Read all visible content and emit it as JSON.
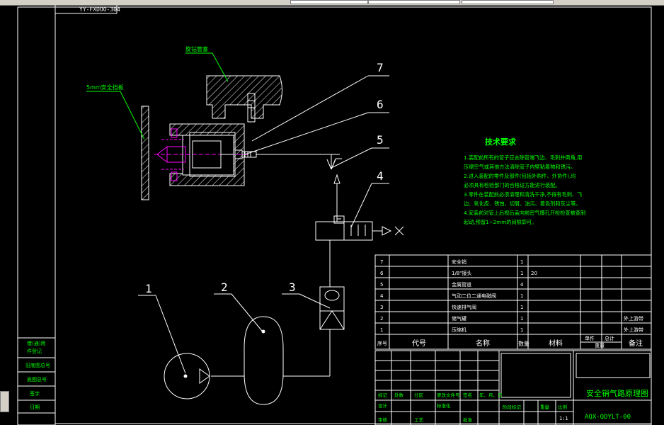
{
  "header_label": "YY-FXDOO-304",
  "colors": {
    "frame": "#ffffff",
    "leader": "#00ff00",
    "accent": "#ff00ff",
    "annotation": "#00ff00",
    "text": "#ffffff"
  },
  "callouts": {
    "air_pipe": "旋钻管塞",
    "safety_plate": "5mm安全挡板"
  },
  "part_numbers": [
    "1",
    "2",
    "3",
    "4",
    "5",
    "6",
    "7"
  ],
  "tech_req": {
    "title": "技术要求",
    "lines": [
      "1.装配前所有的管子应去除管端飞边、毛刺并倒角,用",
      "压缩空气或其他方法清除管子内壁粘着物和锈污。",
      "2.进入装配的零件及部件(包括外购件、外协件),均",
      "必须具有检验部门的合格证方能进行装配。",
      "3.零件在装配前必须清理和清洗干净,不得有毛刺、飞",
      "边、氧化皮、锈蚀、切屑、油污、着色剂和灰尘等。",
      "4.安装前对管上后视后盖向前密气爆孔开检检查被查制",
      "起动,预留1~2mm的间隙即可。"
    ]
  },
  "bom": {
    "rows": [
      {
        "no": "7",
        "name": "安全销",
        "qty": "1",
        "material": "",
        "note": ""
      },
      {
        "no": "6",
        "name": "1/8\"接头",
        "qty": "1",
        "material": "20",
        "note": ""
      },
      {
        "no": "5",
        "name": "金属管道",
        "qty": "4",
        "material": "",
        "note": ""
      },
      {
        "no": "4",
        "name": "气动二位二通电磁阀",
        "qty": "1",
        "material": "",
        "note": ""
      },
      {
        "no": "3",
        "name": "快速排气阀",
        "qty": "1",
        "material": "",
        "note": ""
      },
      {
        "no": "2",
        "name": "储气罐",
        "qty": "1",
        "material": "",
        "note": "外上游带"
      },
      {
        "no": "1",
        "name": "压缩机",
        "qty": "1",
        "material": "",
        "note": "外上游带"
      }
    ],
    "headers": {
      "seq": "序号",
      "code": "代号",
      "name": "名称",
      "qty": "数量",
      "material": "材料",
      "unit": "单件",
      "total": "总计",
      "weight": "重量",
      "note": "备注"
    }
  },
  "title_block": {
    "title": "安全销气路原理图",
    "drawing_no": "AQX-QDYLT-00",
    "scale": "1:1",
    "cells": [
      "标记",
      "处数",
      "分区",
      "更改文件号",
      "签名",
      "年、月、日",
      "设计",
      "标准化",
      "阶段标记",
      "重量",
      "比例",
      "审核",
      "工艺",
      "批准"
    ]
  },
  "left_strip": [
    "借(通)用",
    "件登记",
    "旧底图总号",
    "底图总号",
    "签字",
    "日期"
  ]
}
